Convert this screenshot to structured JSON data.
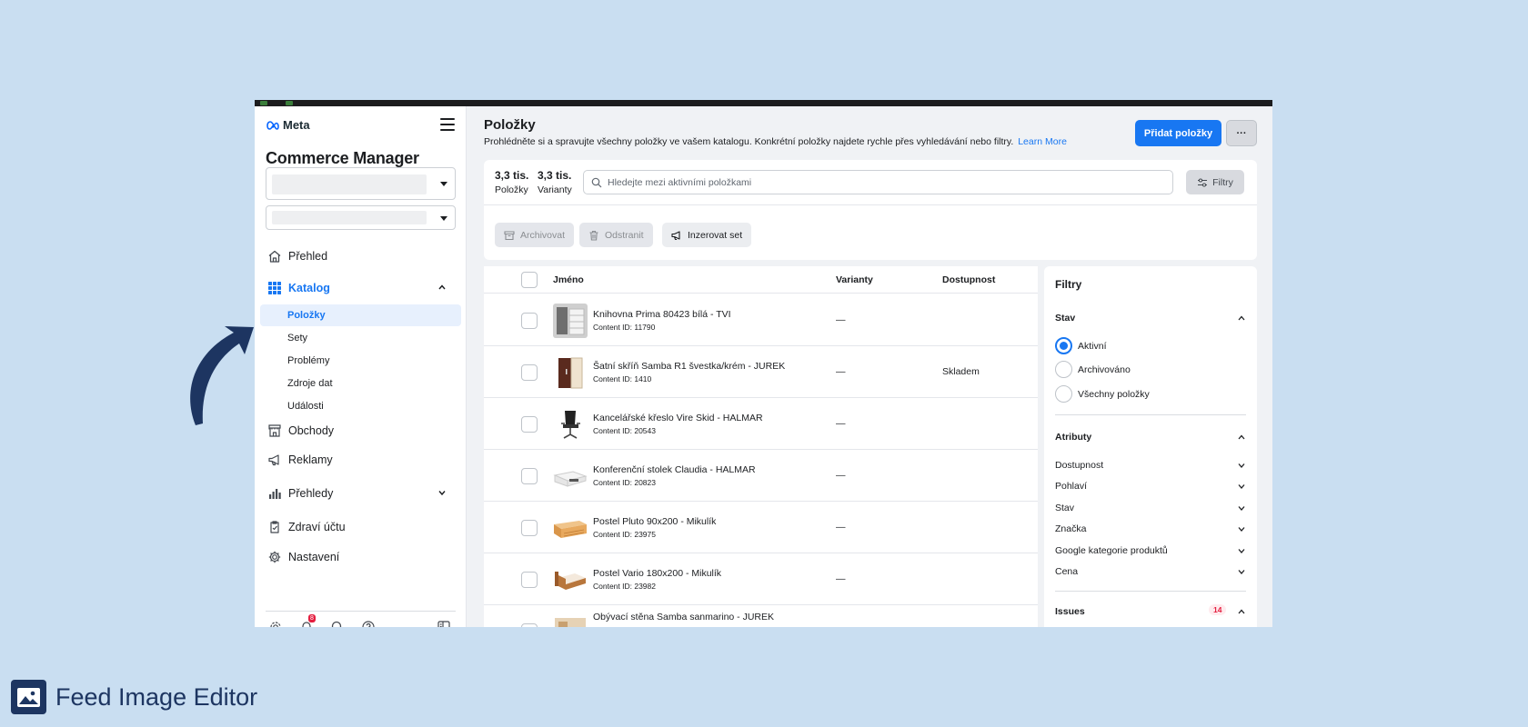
{
  "brand": {
    "meta_label": "Meta",
    "app_title": "Commerce Manager"
  },
  "sidebar": {
    "items": [
      {
        "label": "Přehled"
      },
      {
        "label": "Katalog"
      },
      {
        "label": "Obchody"
      },
      {
        "label": "Reklamy"
      },
      {
        "label": "Přehledy"
      },
      {
        "label": "Zdraví účtu"
      },
      {
        "label": "Nastavení"
      }
    ],
    "catalog_sub": [
      {
        "label": "Položky"
      },
      {
        "label": "Sety"
      },
      {
        "label": "Problémy"
      },
      {
        "label": "Zdroje dat"
      },
      {
        "label": "Události"
      }
    ],
    "notification_count": "8"
  },
  "header": {
    "title": "Položky",
    "description": "Prohlédněte si a spravujte všechny položky ve vašem katalogu. Konkrétní položky najdete rychle přes vyhledávání nebo filtry.",
    "learn_more": "Learn More",
    "add_button": "Přidat položky",
    "more_button": "···"
  },
  "stats": {
    "items_count": "3,3 tis.",
    "items_label": "Položky",
    "variants_count": "3,3 tis.",
    "variants_label": "Varianty"
  },
  "search": {
    "placeholder": "Hledejte mezi aktivními položkami",
    "value": ""
  },
  "filter_button": "Filtry",
  "actions": {
    "archive": "Archivovat",
    "delete": "Odstranit",
    "advertise": "Inzerovat set"
  },
  "table": {
    "columns": {
      "name": "Jméno",
      "variants": "Varianty",
      "availability": "Dostupnost"
    },
    "rows": [
      {
        "name": "Knihovna Prima 80423 bílá - TVI",
        "content_id": "Content ID: 11790",
        "variants": "—",
        "availability": ""
      },
      {
        "name": "Šatní skříň Samba R1 švestka/krém - JUREK",
        "content_id": "Content ID: 1410",
        "variants": "—",
        "availability": "Skladem"
      },
      {
        "name": "Kancelářské křeslo Vire Skid - HALMAR",
        "content_id": "Content ID: 20543",
        "variants": "—",
        "availability": ""
      },
      {
        "name": "Konferenční stolek Claudia - HALMAR",
        "content_id": "Content ID: 20823",
        "variants": "—",
        "availability": ""
      },
      {
        "name": "Postel Pluto 90x200 - Mikulík",
        "content_id": "Content ID: 23975",
        "variants": "—",
        "availability": ""
      },
      {
        "name": "Postel Vario 180x200 - Mikulík",
        "content_id": "Content ID: 23982",
        "variants": "—",
        "availability": ""
      },
      {
        "name": "Obývací stěna Samba sanmarino - JUREK",
        "content_id": "",
        "variants": "",
        "availability": ""
      }
    ]
  },
  "filters_panel": {
    "title": "Filtry",
    "status_label": "Stav",
    "status_options": [
      "Aktivní",
      "Archivováno",
      "Všechny položky"
    ],
    "selected_status": "Aktivní",
    "attributes_label": "Atributy",
    "attributes": [
      "Dostupnost",
      "Pohlaví",
      "Stav",
      "Značka",
      "Google kategorie produktů",
      "Cena"
    ],
    "issues_label": "Issues",
    "issues_count": "14"
  },
  "footer": {
    "label": "Feed Image Editor"
  },
  "colors": {
    "accent": "#1877f2",
    "background": "#c9def1",
    "footer_brand": "#1d3561",
    "badge_red": "#e41e3f"
  }
}
